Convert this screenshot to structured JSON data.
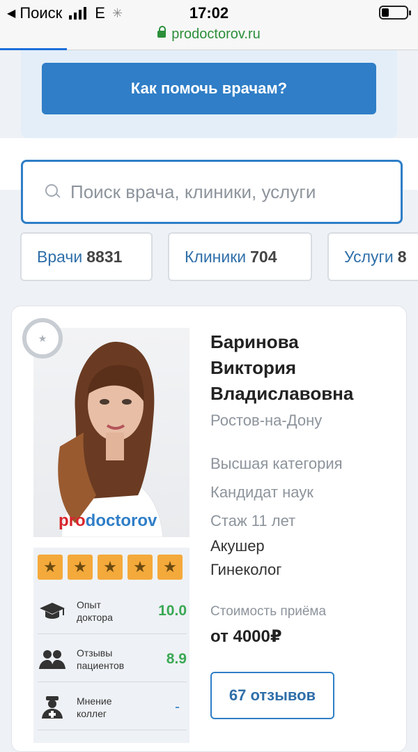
{
  "status_bar": {
    "back_label": "Поиск",
    "network": "E",
    "time": "17:02"
  },
  "url_bar": {
    "url": "prodoctorov.ru",
    "load_progress": 0.16
  },
  "help_button": {
    "label": "Как помочь врачам?"
  },
  "search": {
    "placeholder": "Поиск врача, клиники, услуги",
    "value": ""
  },
  "tabs": [
    {
      "label": "Врачи",
      "count": "8831"
    },
    {
      "label": "Клиники",
      "count": "704"
    },
    {
      "label": "Услуги",
      "count": "8"
    }
  ],
  "doctor": {
    "name_line1": "Баринова",
    "name_line2": "Виктория",
    "name_line3": "Владиславовна",
    "city": "Ростов-на-Дону",
    "category": "Высшая категория",
    "degree": "Кандидат наук",
    "experience": "Стаж 11 лет",
    "specialty1": "Акушер",
    "specialty2": "Гинеколог",
    "cost_label": "Стоимость приёма",
    "cost": "от 4000₽",
    "reviews_label": "67 отзывов",
    "photo_watermark_pro": "pro",
    "photo_watermark_rest": "doctorov",
    "stars": 5,
    "metrics": [
      {
        "label_line1": "Опыт",
        "label_line2": "доктора",
        "value": "10.0",
        "icon": "graduation-cap-icon"
      },
      {
        "label_line1": "Отзывы",
        "label_line2": "пациентов",
        "value": "8.9",
        "icon": "patients-icon"
      },
      {
        "label_line1": "Мнение",
        "label_line2": "коллег",
        "value": "-",
        "icon": "doctor-icon"
      }
    ]
  },
  "colors": {
    "accent": "#2f7ec7",
    "star": "#f4a93b",
    "good_score": "#3aa854",
    "url_green": "#2c8f3a"
  }
}
